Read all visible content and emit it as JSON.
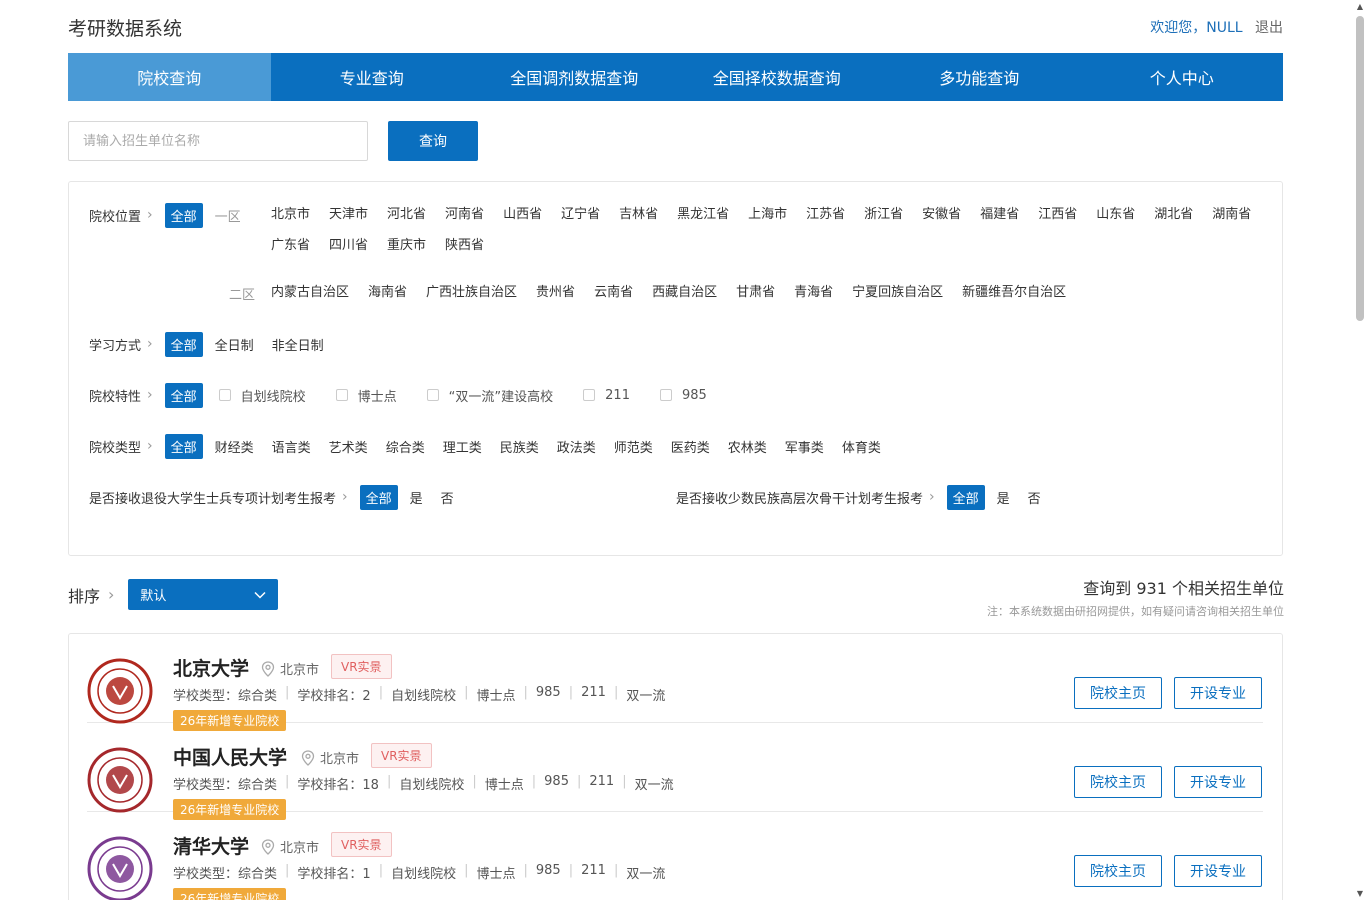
{
  "app_title": "考研数据系统",
  "user": {
    "welcome": "欢迎您，NULL",
    "logout": "退出"
  },
  "nav": [
    "院校查询",
    "专业查询",
    "全国调剂数据查询",
    "全国择校数据查询",
    "多功能查询",
    "个人中心"
  ],
  "search": {
    "placeholder": "请输入招生单位名称",
    "button": "查询"
  },
  "filters": {
    "location": {
      "label": "院校位置",
      "all": "全部",
      "zone1_label": "一区",
      "zone1": [
        "北京市",
        "天津市",
        "河北省",
        "河南省",
        "山西省",
        "辽宁省",
        "吉林省",
        "黑龙江省",
        "上海市",
        "江苏省",
        "浙江省",
        "安徽省",
        "福建省",
        "江西省",
        "山东省",
        "湖北省",
        "湖南省",
        "广东省",
        "四川省",
        "重庆市",
        "陕西省"
      ],
      "zone2_label": "二区",
      "zone2": [
        "内蒙古自治区",
        "海南省",
        "广西壮族自治区",
        "贵州省",
        "云南省",
        "西藏自治区",
        "甘肃省",
        "青海省",
        "宁夏回族自治区",
        "新疆维吾尔自治区"
      ]
    },
    "study": {
      "label": "学习方式",
      "all": "全部",
      "options": [
        "全日制",
        "非全日制"
      ]
    },
    "feature": {
      "label": "院校特性",
      "all": "全部",
      "options": [
        "自划线院校",
        "博士点",
        "“双一流”建设高校",
        "211",
        "985"
      ]
    },
    "type": {
      "label": "院校类型",
      "all": "全部",
      "options": [
        "财经类",
        "语言类",
        "艺术类",
        "综合类",
        "理工类",
        "民族类",
        "政法类",
        "师范类",
        "医药类",
        "农林类",
        "军事类",
        "体育类"
      ]
    },
    "soldier": {
      "label": "是否接收退役大学生士兵专项计划考生报考",
      "all": "全部",
      "yes": "是",
      "no": "否"
    },
    "minority": {
      "label": "是否接收少数民族高层次骨干计划考生报考",
      "all": "全部",
      "yes": "是",
      "no": "否"
    }
  },
  "sort": {
    "label": "排序",
    "value": "默认"
  },
  "result": {
    "count_text": "查询到 931 个相关招生单位",
    "note": "注：本系统数据由研招网提供，如有疑问请咨询相关招生单位"
  },
  "universities": [
    {
      "name": "北京大学",
      "location": "北京市",
      "vr": "VR实景",
      "type": "学校类型：综合类",
      "rank": "学校排名：2",
      "tags": [
        "自划线院校",
        "博士点",
        "985",
        "211",
        "双一流"
      ],
      "badge": "26年新增专业院校",
      "btn_home": "院校主页",
      "btn_major": "开设专业",
      "color": "#b0281e"
    },
    {
      "name": "中国人民大学",
      "location": "北京市",
      "vr": "VR实景",
      "type": "学校类型：综合类",
      "rank": "学校排名：18",
      "tags": [
        "自划线院校",
        "博士点",
        "985",
        "211",
        "双一流"
      ],
      "badge": "26年新增专业院校",
      "btn_home": "院校主页",
      "btn_major": "开设专业",
      "color": "#a5282c"
    },
    {
      "name": "清华大学",
      "location": "北京市",
      "vr": "VR实景",
      "type": "学校类型：综合类",
      "rank": "学校排名：1",
      "tags": [
        "自划线院校",
        "博士点",
        "985",
        "211",
        "双一流"
      ],
      "badge": "26年新增专业院校",
      "btn_home": "院校主页",
      "btn_major": "开设专业",
      "color": "#7a3b8f"
    }
  ]
}
